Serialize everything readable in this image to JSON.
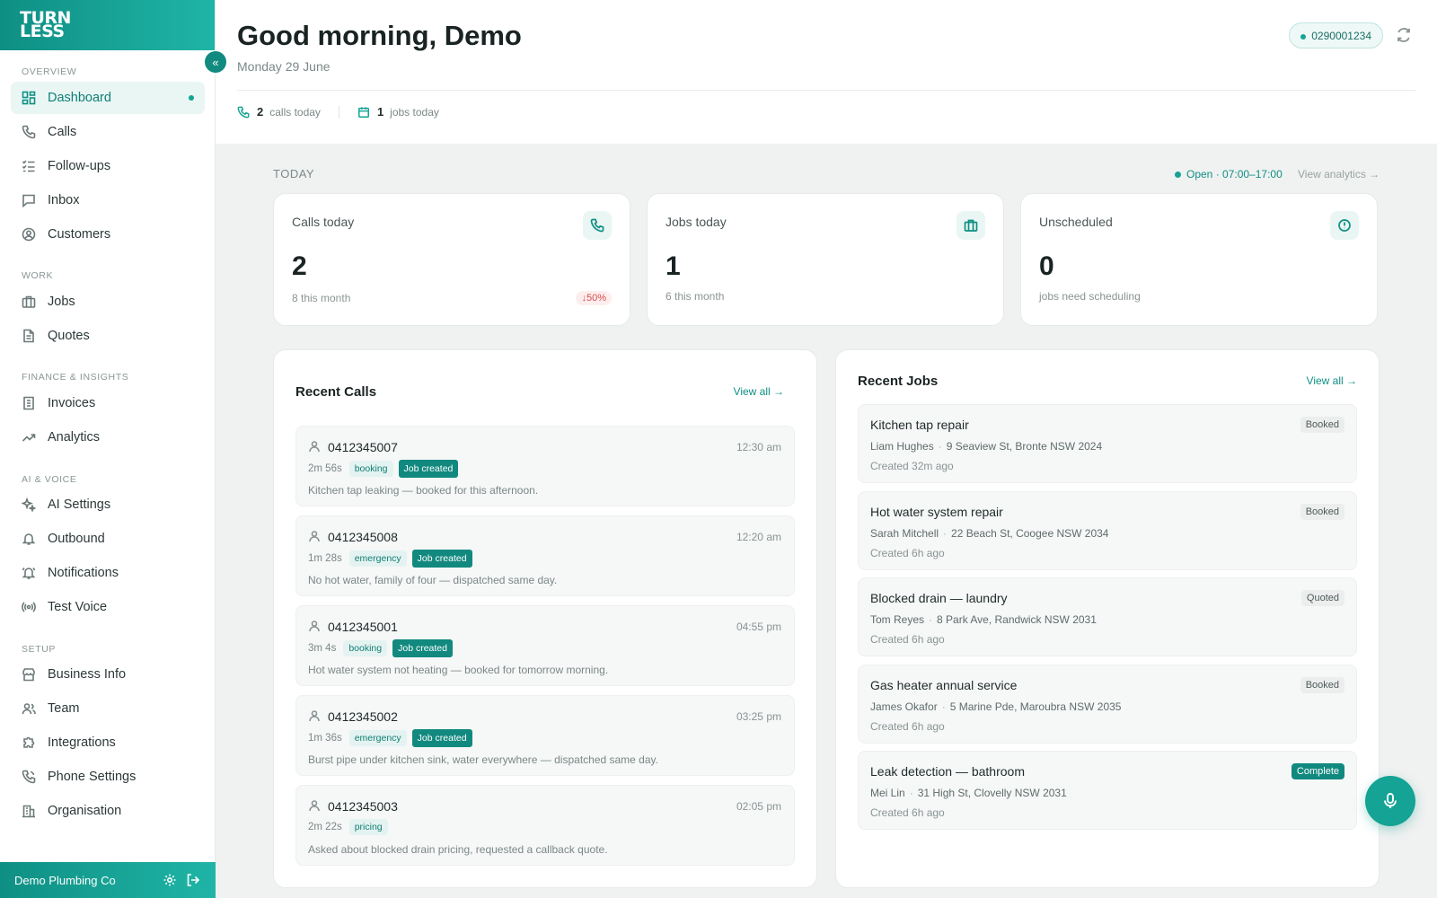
{
  "brand": {
    "logo_line1": "TURN",
    "logo_line2": "LESS"
  },
  "sidebar": {
    "collapse_glyph": "«",
    "sections": [
      {
        "label": "OVERVIEW"
      },
      {
        "label": "WORK"
      },
      {
        "label": "FINANCE & INSIGHTS"
      },
      {
        "label": "AI & VOICE"
      },
      {
        "label": "SETUP"
      }
    ],
    "items": [
      {
        "label": "Dashboard",
        "icon": "dashboard-icon",
        "active": true
      },
      {
        "label": "Calls",
        "icon": "phone-icon"
      },
      {
        "label": "Follow-ups",
        "icon": "checklist-icon"
      },
      {
        "label": "Inbox",
        "icon": "message-icon"
      },
      {
        "label": "Customers",
        "icon": "user-circle-icon"
      },
      {
        "label": "Jobs",
        "icon": "briefcase-icon"
      },
      {
        "label": "Quotes",
        "icon": "document-icon"
      },
      {
        "label": "Invoices",
        "icon": "invoice-icon"
      },
      {
        "label": "Analytics",
        "icon": "trend-icon"
      },
      {
        "label": "AI Settings",
        "icon": "sparkles-icon"
      },
      {
        "label": "Outbound",
        "icon": "bell-icon"
      },
      {
        "label": "Notifications",
        "icon": "bell-ring-icon"
      },
      {
        "label": "Test Voice",
        "icon": "broadcast-icon"
      },
      {
        "label": "Business Info",
        "icon": "store-icon"
      },
      {
        "label": "Team",
        "icon": "team-icon"
      },
      {
        "label": "Integrations",
        "icon": "puzzle-icon"
      },
      {
        "label": "Phone Settings",
        "icon": "phone-settings-icon"
      },
      {
        "label": "Organisation",
        "icon": "building-icon"
      }
    ],
    "footer": {
      "org_name": "Demo Plumbing Co"
    }
  },
  "header": {
    "greeting": "Good morning, Demo",
    "date": "Monday 29 June",
    "phone_number": "0290001234",
    "calls_today_count": "2",
    "calls_today_label": "calls today",
    "jobs_today_count": "1",
    "jobs_today_label": "jobs today"
  },
  "today": {
    "label": "TODAY",
    "open_status": "Open · 07:00–17:00",
    "view_analytics": "View analytics →"
  },
  "stat_cards": [
    {
      "label": "Calls today",
      "value": "2",
      "sub": "8 this month",
      "trend": "↓50%",
      "icon": "phone-icon"
    },
    {
      "label": "Jobs today",
      "value": "1",
      "sub": "6 this month",
      "icon": "briefcase-icon"
    },
    {
      "label": "Unscheduled",
      "value": "0",
      "sub": "jobs need scheduling",
      "icon": "alert-circle-icon"
    }
  ],
  "recent_calls": {
    "title": "Recent Calls",
    "view_all": "View all →",
    "items": [
      {
        "number": "0412345007",
        "time": "12:30 am",
        "duration": "2m 56s",
        "tag": "booking",
        "badge": "Job created",
        "summary": "Kitchen tap leaking — booked for this afternoon."
      },
      {
        "number": "0412345008",
        "time": "12:20 am",
        "duration": "1m 28s",
        "tag": "emergency",
        "badge": "Job created",
        "summary": "No hot water, family of four — dispatched same day."
      },
      {
        "number": "0412345001",
        "time": "04:55 pm",
        "duration": "3m 4s",
        "tag": "booking",
        "badge": "Job created",
        "summary": "Hot water system not heating — booked for tomorrow morning."
      },
      {
        "number": "0412345002",
        "time": "03:25 pm",
        "duration": "1m 36s",
        "tag": "emergency",
        "badge": "Job created",
        "summary": "Burst pipe under kitchen sink, water everywhere — dispatched same day."
      },
      {
        "number": "0412345003",
        "time": "02:05 pm",
        "duration": "2m 22s",
        "tag": "pricing",
        "badge": "",
        "summary": "Asked about blocked drain pricing, requested a callback quote."
      }
    ]
  },
  "recent_jobs": {
    "title": "Recent Jobs",
    "view_all": "View all →",
    "items": [
      {
        "title": "Kitchen tap repair",
        "customer": "Liam Hughes",
        "address": "9 Seaview St, Bronte NSW 2024",
        "created": "Created 32m ago",
        "status": "Booked"
      },
      {
        "title": "Hot water system repair",
        "customer": "Sarah Mitchell",
        "address": "22 Beach St, Coogee NSW 2034",
        "created": "Created 6h ago",
        "status": "Booked"
      },
      {
        "title": "Blocked drain — laundry",
        "customer": "Tom Reyes",
        "address": "8 Park Ave, Randwick NSW 2031",
        "created": "Created 6h ago",
        "status": "Quoted"
      },
      {
        "title": "Gas heater annual service",
        "customer": "James Okafor",
        "address": "5 Marine Pde, Maroubra NSW 2035",
        "created": "Created 6h ago",
        "status": "Booked"
      },
      {
        "title": "Leak detection — bathroom",
        "customer": "Mei Lin",
        "address": "31 High St, Clovelly NSW 2031",
        "created": "Created 6h ago",
        "status": "Complete"
      }
    ]
  },
  "colors": {
    "accent": "#14a394",
    "accent_dark": "#0f8f84",
    "danger": "#d64b4b"
  }
}
